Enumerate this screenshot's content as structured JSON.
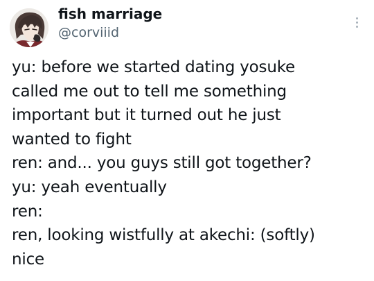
{
  "author": {
    "display_name": "fish marriage",
    "handle": "@corviiid"
  },
  "menu": {
    "icon": "more-vertical-icon"
  },
  "post": {
    "lines": [
      "yu: before we started dating yosuke",
      "called me out to tell me something",
      "important but it turned out he just",
      "wanted to fight",
      "ren: and... you guys still got together?",
      "yu: yeah eventually",
      "ren:",
      "ren, looking wistfully at akechi: (softly)",
      "nice"
    ]
  }
}
